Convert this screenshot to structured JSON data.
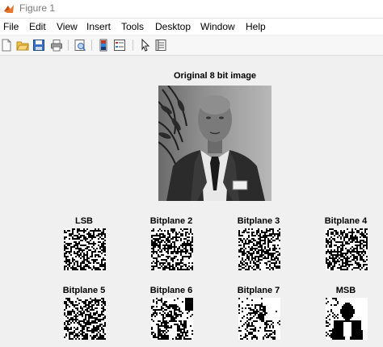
{
  "window": {
    "title": "Figure 1",
    "icon": "matlab-logo-icon"
  },
  "menu": [
    "File",
    "Edit",
    "View",
    "Insert",
    "Tools",
    "Desktop",
    "Window",
    "Help"
  ],
  "toolbar": {
    "icons": [
      "new-figure-icon",
      "open-file-icon",
      "save-icon",
      "print-icon",
      "print-preview-icon",
      "colorbar-icon",
      "legend-icon",
      "select-pointer-icon",
      "property-inspector-icon"
    ]
  },
  "figure": {
    "main_title": "Original 8 bit image",
    "bitplanes": [
      {
        "title": "LSB"
      },
      {
        "title": "Bitplane 2"
      },
      {
        "title": "Bitplane 3"
      },
      {
        "title": "Bitplane 4"
      },
      {
        "title": "Bitplane 5"
      },
      {
        "title": "Bitplane 6"
      },
      {
        "title": "Bitplane 7"
      },
      {
        "title": "MSB"
      }
    ]
  }
}
